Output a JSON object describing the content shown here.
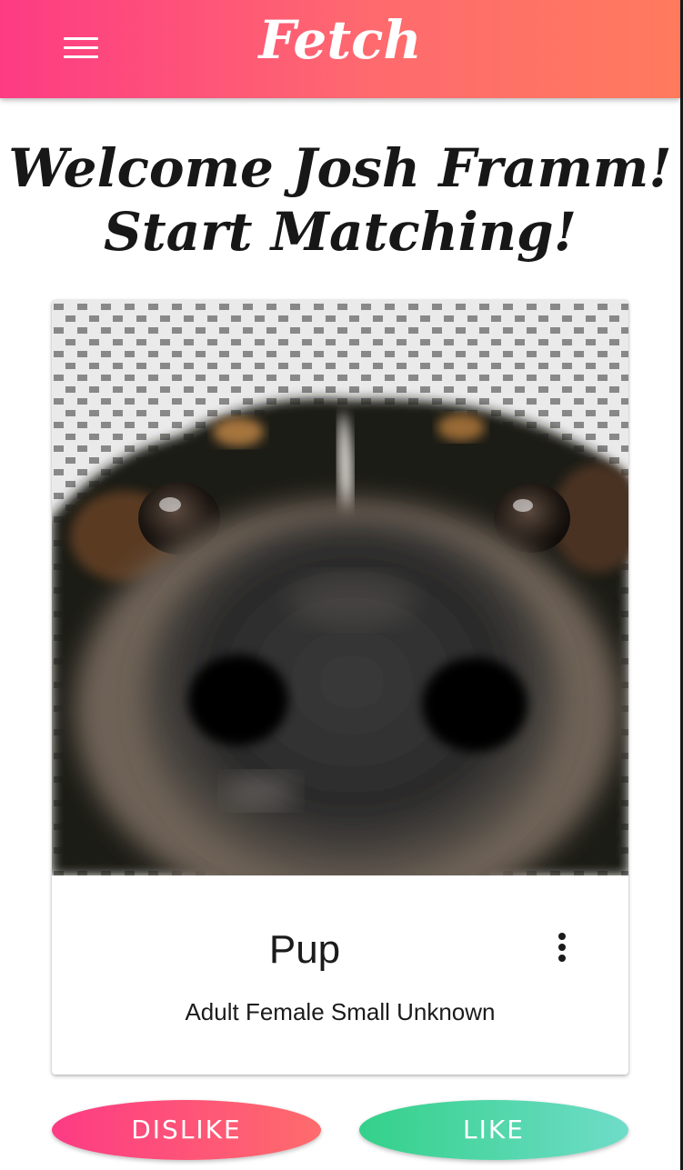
{
  "header": {
    "logo_text": "Fetch",
    "menu_icon": "hamburger-menu-icon"
  },
  "welcome": {
    "line1": "Welcome Josh Framm!",
    "line2": "Start Matching!"
  },
  "card": {
    "pet_name": "Pup",
    "pet_info": "Adult Female Small Unknown",
    "more_icon": "more-vertical-icon"
  },
  "actions": {
    "dislike_label": "DISLIKE",
    "like_label": "LIKE"
  },
  "colors": {
    "brand_pink": "#fd3b84",
    "brand_coral": "#ff7a5d",
    "like_green": "#34d18a",
    "like_teal": "#6fdcc8"
  }
}
